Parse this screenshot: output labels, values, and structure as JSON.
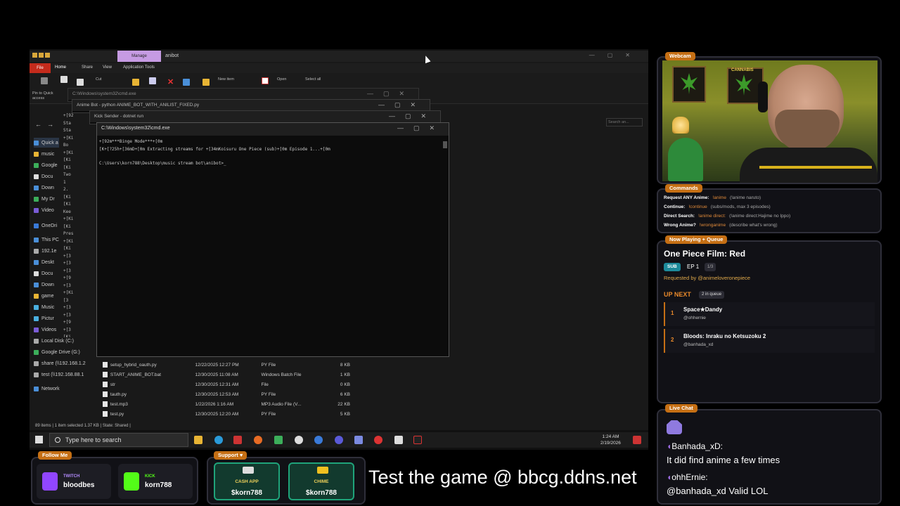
{
  "desktop": {
    "explorer": {
      "manage_tab": "Manage",
      "app_name": "anibot",
      "ribbon_tabs": [
        "File",
        "Home",
        "Share",
        "View",
        "Application Tools"
      ],
      "ribbon_buttons": {
        "pin": "Pin to Quick access",
        "cut": "Cut",
        "new_item": "New item",
        "open": "Open",
        "select_all": "Select all"
      },
      "search_placeholder": "Search an...",
      "nav_items": [
        "Quick a",
        "music",
        "Google",
        "Docu",
        "Down",
        "My Dr",
        "Video",
        "OneDri",
        "This PC",
        "192.1e",
        "Deskt",
        "Docu",
        "Down",
        "game",
        "Music",
        "Pictur",
        "Videos",
        "Local Disk (C:)",
        "Google Drive (G:)",
        "share (\\\\192.168.1.2",
        "test (\\\\192.168.88.1",
        "Network"
      ],
      "files": [
        {
          "name": "setup_hybrid_oauth.py",
          "date": "12/22/2025 12:27 PM",
          "type": "PY File",
          "size": "8 KB"
        },
        {
          "name": "START_ANIME_BOT.bat",
          "date": "12/30/2025 11:08 AM",
          "type": "Windows Batch File",
          "size": "1 KB"
        },
        {
          "name": "str",
          "date": "12/30/2025 12:31 AM",
          "type": "File",
          "size": "0 KB"
        },
        {
          "name": "tauth.py",
          "date": "12/30/2025 12:53 AM",
          "type": "PY File",
          "size": "6 KB"
        },
        {
          "name": "test.mp3",
          "date": "1/22/2026 1:16 AM",
          "type": "MP3 Audio File (V...",
          "size": "22 KB"
        },
        {
          "name": "test.py",
          "date": "12/30/2025 12:20 AM",
          "type": "PY File",
          "size": "5 KB"
        }
      ],
      "status": "89 items  |  1 item selected  1.37 KB  |  State: Shared  |"
    },
    "bg_windows": [
      "C:\\Windows\\system32\\cmd.exe",
      "Anime Bot - python  ANIME_BOT_WITH_ANILIST_FIXED.py",
      "Kick Sender - dotnet  run"
    ],
    "left_log": "+[92\nSta\nSta\n+[Ki\nBo\n+[Ki\n[Ki\n[Ki\nTwo\n1\n2.\n[Ki\n[Ki\nKee\n+[Ki\n[Ki\nPres\n+[Ki\n[Ki\n+[3\n+[3\n+[3\n+[9\n+[3\n+[Ki\n[3\n+[3\n+[3\n+[9\n+[3\n[Ki\n+[3\n[Ki\n[Ki\n[Ki",
    "cmd_main": {
      "title": "C:\\Windows\\system32\\cmd.exe",
      "line1": "+[92m***Binge Mode***+[0m",
      "line2": "[K+[?25h+[36mD+[0m Extracting streams for +[34mKoisuru One Piece (sub)+[0m Episode 1...+[0m",
      "line3": "C:\\Users\\korn788\\Desktop\\music stream bot\\anibot>_"
    },
    "taskbar": {
      "search_placeholder": "Type here to search",
      "time": "1:24 AM",
      "date": "2/19/2026"
    }
  },
  "overlay": {
    "webcam": {
      "label": "Webcam",
      "poster_text": "CANNABIS"
    },
    "commands": {
      "label": "Commands",
      "items": [
        {
          "label": "Request ANY Anime:",
          "cmd": "!anime",
          "desc": "(!anime naruto)"
        },
        {
          "label": "Continue:",
          "cmd": "!continue",
          "desc": "(subs/mods, max 3 episodes)"
        },
        {
          "label": "Direct Search:",
          "cmd": "!anime direct:",
          "desc": "(!anime direct:Hajime no Ippo)"
        },
        {
          "label": "Wrong Anime?",
          "cmd": "!wronganime",
          "desc": "(describe what's wrong)"
        }
      ]
    },
    "now_playing": {
      "label": "Now Playing + Queue",
      "title": "One Piece Film: Red",
      "badge": "SUB",
      "episode": "EP 1",
      "count": "1/3",
      "requested_by": "Requested by @animeloveronepiece",
      "up_next_label": "UP NEXT",
      "queue_count": "2 in queue",
      "queue": [
        {
          "num": "1",
          "title": "Space★Dandy",
          "user": "@ohhernie"
        },
        {
          "num": "2",
          "title": "Bloods: Inraku no Ketsuzoku 2",
          "user": "@banhada_xd"
        }
      ]
    },
    "live_chat": {
      "label": "Live Chat",
      "messages": [
        {
          "name": "Banhada_xD:",
          "text": "It did find anime a few times"
        },
        {
          "name": "ohhErnie:",
          "text": "@banhada_xd Valid LOL"
        }
      ]
    },
    "follow": {
      "label": "Follow Me",
      "twitch_label": "TWITCH",
      "twitch_user": "bloodbes",
      "kick_label": "KICK",
      "kick_user": "korn788"
    },
    "support": {
      "label": "Support ♥",
      "cashapp_label": "CASH APP",
      "cashapp_user": "$korn788",
      "chime_label": "CHIME",
      "chime_user": "$korn788"
    },
    "promo": "Test the game @ bbcg.ddns.net"
  },
  "colors": {
    "accent": "#c56f14",
    "teal": "#1d8a9a",
    "support_green": "#1fa37a",
    "twitch": "#9146ff",
    "kick": "#53fc18"
  }
}
